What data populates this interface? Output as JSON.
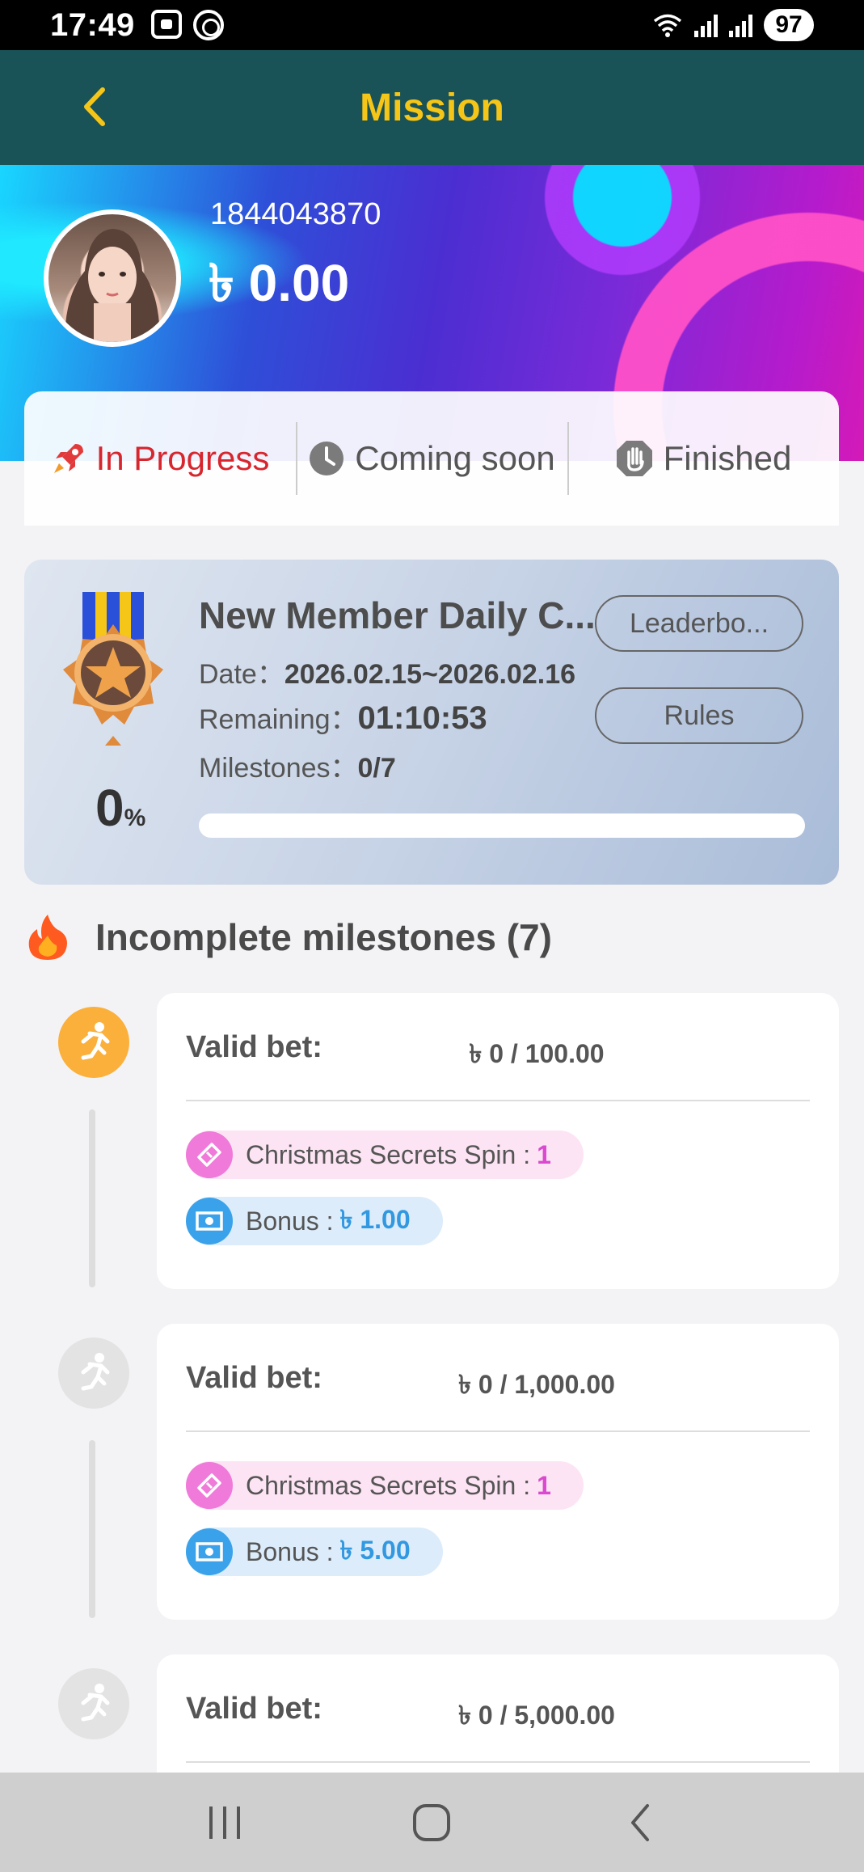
{
  "status_bar": {
    "time": "17:49",
    "signal_label": "5",
    "battery": "97"
  },
  "header": {
    "title": "Mission"
  },
  "profile": {
    "user_id": "1844043870",
    "balance": "৳ 0.00"
  },
  "tabs": [
    {
      "label": "In Progress",
      "icon": "rocket-icon",
      "active": true
    },
    {
      "label": "Coming soon",
      "icon": "clock-icon",
      "active": false
    },
    {
      "label": "Finished",
      "icon": "hand-stop-icon",
      "active": false
    }
  ],
  "event": {
    "title": "New Member Daily C...",
    "date_label": "Date：",
    "date_value": "2026.02.15~2026.02.16",
    "remaining_label": "Remaining：",
    "remaining_value": "01:10:53",
    "milestones_label": "Milestones：",
    "milestones_value": "0/7",
    "percent": "0",
    "percent_unit": "%",
    "progress_fraction": 0,
    "leaderboard_label": "Leaderbo...",
    "rules_label": "Rules"
  },
  "section": {
    "title": "Incomplete milestones (7)"
  },
  "milestones": [
    {
      "label": "Valid bet:",
      "value": "৳ 0 / 100.00",
      "active": true,
      "spin_label": "Christmas Secrets Spin : ",
      "spin_value": "1",
      "bonus_label": "Bonus : ",
      "bonus_value": "৳ 1.00"
    },
    {
      "label": "Valid bet:",
      "value": "৳ 0 / 1,000.00",
      "active": false,
      "spin_label": "Christmas Secrets Spin : ",
      "spin_value": "1",
      "bonus_label": "Bonus : ",
      "bonus_value": "৳ 5.00"
    },
    {
      "label": "Valid bet:",
      "value": "৳ 0 / 5,000.00",
      "active": false
    }
  ],
  "colors": {
    "header_bg": "#1a5357",
    "accent_gold": "#f5c518",
    "active_tab": "#d7262e",
    "milestone_active": "#fbb03b",
    "milestone_inactive": "#e3e3e3"
  }
}
